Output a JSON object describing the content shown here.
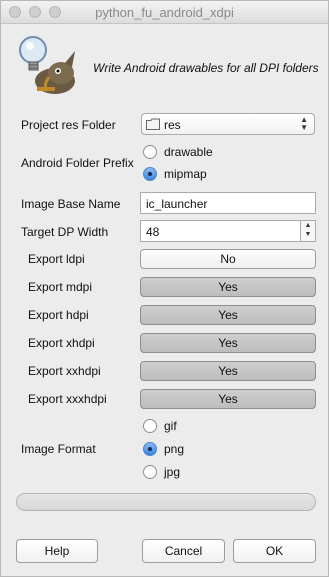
{
  "window": {
    "title": "python_fu_android_xdpi"
  },
  "header": {
    "text": "Write Android drawables for all DPI folders"
  },
  "project_folder": {
    "label": "Project res Folder",
    "value": "res"
  },
  "folder_prefix": {
    "label": "Android Folder Prefix",
    "options": [
      {
        "label": "drawable",
        "selected": false
      },
      {
        "label": "mipmap",
        "selected": true
      }
    ]
  },
  "image_base_name": {
    "label": "Image Base Name",
    "value": "ic_launcher"
  },
  "target_dp_width": {
    "label": "Target DP Width",
    "value": "48"
  },
  "exports": [
    {
      "label": "Export ldpi",
      "value": "No",
      "on": false
    },
    {
      "label": "Export mdpi",
      "value": "Yes",
      "on": true
    },
    {
      "label": "Export hdpi",
      "value": "Yes",
      "on": true
    },
    {
      "label": "Export xhdpi",
      "value": "Yes",
      "on": true
    },
    {
      "label": "Export xxhdpi",
      "value": "Yes",
      "on": true
    },
    {
      "label": "Export xxxhdpi",
      "value": "Yes",
      "on": true
    }
  ],
  "image_format": {
    "label": "Image Format",
    "options": [
      {
        "label": "gif",
        "selected": false
      },
      {
        "label": "png",
        "selected": true
      },
      {
        "label": "jpg",
        "selected": false
      }
    ]
  },
  "buttons": {
    "help": "Help",
    "cancel": "Cancel",
    "ok": "OK"
  },
  "colors": {
    "accent": "#3f82dc"
  }
}
